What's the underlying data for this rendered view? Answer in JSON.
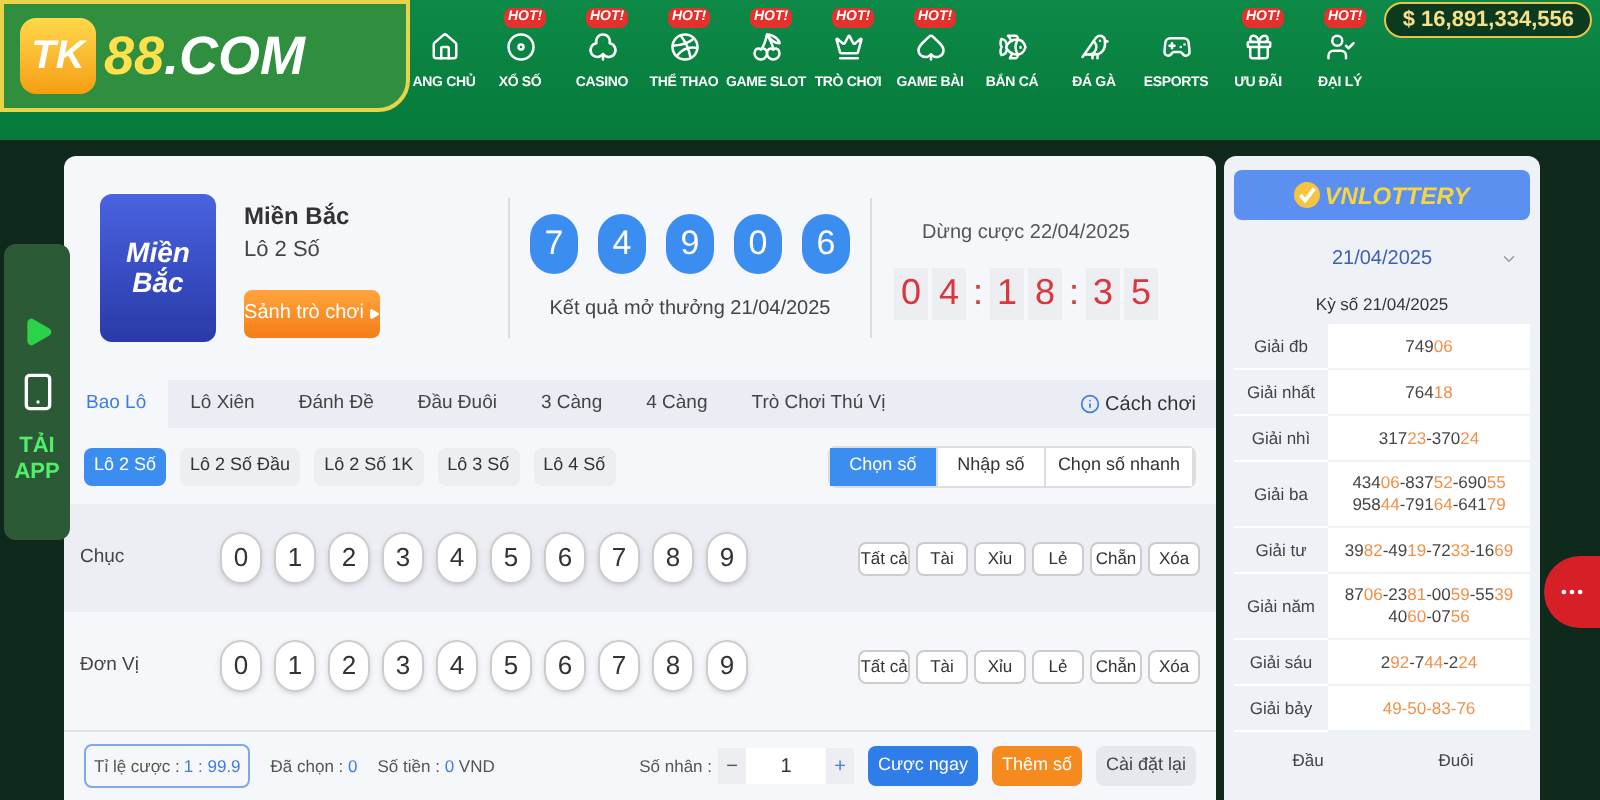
{
  "header": {
    "brand": {
      "mark": "TK",
      "accent": "88",
      "rest": ".COM"
    },
    "nav": [
      {
        "label": "ANG CHỦ"
      },
      {
        "label": "XỔ SỐ",
        "badge": "HOT!"
      },
      {
        "label": "CASINO",
        "badge": "HOT!"
      },
      {
        "label": "THỂ THAO",
        "badge": "HOT!"
      },
      {
        "label": "GAME SLOT",
        "badge": "HOT!"
      },
      {
        "label": "TRÒ CHƠI",
        "badge": "HOT!"
      },
      {
        "label": "GAME BÀI",
        "badge": "HOT!"
      },
      {
        "label": "BẮN CÁ"
      },
      {
        "label": "ĐÁ GÀ"
      },
      {
        "label": "ESPORTS"
      },
      {
        "label": "ƯU ĐÃI",
        "badge": "HOT!"
      },
      {
        "label": "ĐẠI LÝ",
        "badge": "HOT!"
      }
    ],
    "balance": "$ 16,891,334,556"
  },
  "app_widget": {
    "label": "TẢI APP"
  },
  "game": {
    "icon_text": "Miền Bắc",
    "region": "Miền Bắc",
    "type": "Lô 2 Số",
    "lobby_button": "Sảnh trò chơi",
    "balls": [
      "7",
      "4",
      "9",
      "0",
      "6"
    ],
    "result_caption": "Kết quả mở thưởng 21/04/2025",
    "deadline": "Dừng cược 22/04/2025",
    "countdown": [
      "0",
      "4",
      ":",
      "1",
      "8",
      ":",
      "3",
      "5"
    ]
  },
  "tabs": [
    {
      "label": "Bao Lô",
      "selected": true
    },
    {
      "label": "Lô Xiên",
      "selected": false
    },
    {
      "label": "Đánh Đề",
      "selected": false
    },
    {
      "label": "Đầu Đuôi",
      "selected": false
    },
    {
      "label": "3 Càng",
      "selected": false
    },
    {
      "label": "4 Càng",
      "selected": false
    },
    {
      "label": "Trò Chơi Thú Vị",
      "selected": false
    }
  ],
  "help_link": "Cách chơi",
  "subtabs": [
    {
      "label": "Lô 2 Số",
      "selected": true
    },
    {
      "label": "Lô 2 Số Đầu",
      "selected": false
    },
    {
      "label": "Lô 2 Số 1K",
      "selected": false
    },
    {
      "label": "Lô 3 Số",
      "selected": false
    },
    {
      "label": "Lô 4 Số",
      "selected": false
    }
  ],
  "modes": [
    {
      "label": "Chọn số",
      "selected": true
    },
    {
      "label": "Nhập số",
      "selected": false
    },
    {
      "label": "Chọn số nhanh",
      "selected": false
    }
  ],
  "pick_rows": [
    {
      "label": "Chục",
      "digits": [
        "0",
        "1",
        "2",
        "3",
        "4",
        "5",
        "6",
        "7",
        "8",
        "9"
      ],
      "quick": [
        "Tất cả",
        "Tài",
        "Xỉu",
        "Lẻ",
        "Chẵn",
        "Xóa"
      ]
    },
    {
      "label": "Đơn Vị",
      "digits": [
        "0",
        "1",
        "2",
        "3",
        "4",
        "5",
        "6",
        "7",
        "8",
        "9"
      ],
      "quick": [
        "Tất cả",
        "Tài",
        "Xỉu",
        "Lẻ",
        "Chẵn",
        "Xóa"
      ]
    }
  ],
  "footer": {
    "odds_label": "Tỉ lệ cược : ",
    "odds_value": "1 : 99.9",
    "chosen_label": "Đã chọn : ",
    "chosen_value": "0",
    "amount_label": "Số tiền : ",
    "amount_value": "0",
    "amount_unit": " VND",
    "multiplier_label": "Số nhân :",
    "minus": "−",
    "multiplier": "1",
    "plus": "+",
    "buttons": [
      {
        "label": "Cược ngay",
        "kind": "primary"
      },
      {
        "label": "Thêm số",
        "kind": "accent"
      },
      {
        "label": "Cài đặt lại",
        "kind": "plain"
      }
    ]
  },
  "results": {
    "logo": {
      "lead": "VN",
      "rest": "LOTTERY"
    },
    "date": "21/04/2025",
    "draw": "Kỳ số 21/04/2025",
    "prizes": [
      {
        "name": "Giải đb",
        "lines": [
          [
            {
              "text": "749",
              "hot": false
            },
            {
              "text": "06",
              "hot": true
            }
          ]
        ]
      },
      {
        "name": "Giải nhất",
        "lines": [
          [
            {
              "text": "764",
              "hot": false
            },
            {
              "text": "18",
              "hot": true
            }
          ]
        ]
      },
      {
        "name": "Giải nhì",
        "lines": [
          [
            {
              "text": "317",
              "hot": false
            },
            {
              "text": "23",
              "hot": true
            },
            {
              "text": "-370",
              "hot": false
            },
            {
              "text": "24",
              "hot": true
            }
          ]
        ]
      },
      {
        "name": "Giải ba",
        "lines": [
          [
            {
              "text": "434",
              "hot": false
            },
            {
              "text": "06",
              "hot": true
            },
            {
              "text": "-837",
              "hot": false
            },
            {
              "text": "52",
              "hot": true
            },
            {
              "text": "-690",
              "hot": false
            },
            {
              "text": "55",
              "hot": true
            }
          ],
          [
            {
              "text": "958",
              "hot": false
            },
            {
              "text": "44",
              "hot": true
            },
            {
              "text": "-791",
              "hot": false
            },
            {
              "text": "64",
              "hot": true
            },
            {
              "text": "-641",
              "hot": false
            },
            {
              "text": "79",
              "hot": true
            }
          ]
        ]
      },
      {
        "name": "Giải tư",
        "lines": [
          [
            {
              "text": "39",
              "hot": false
            },
            {
              "text": "82",
              "hot": true
            },
            {
              "text": "-49",
              "hot": false
            },
            {
              "text": "19",
              "hot": true
            },
            {
              "text": "-72",
              "hot": false
            },
            {
              "text": "33",
              "hot": true
            },
            {
              "text": "-16",
              "hot": false
            },
            {
              "text": "69",
              "hot": true
            }
          ]
        ]
      },
      {
        "name": "Giải năm",
        "lines": [
          [
            {
              "text": "87",
              "hot": false
            },
            {
              "text": "06",
              "hot": true
            },
            {
              "text": "-23",
              "hot": false
            },
            {
              "text": "81",
              "hot": true
            },
            {
              "text": "-00",
              "hot": false
            },
            {
              "text": "59",
              "hot": true
            },
            {
              "text": "-55",
              "hot": false
            },
            {
              "text": "39",
              "hot": true
            }
          ],
          [
            {
              "text": "40",
              "hot": false
            },
            {
              "text": "60",
              "hot": true
            },
            {
              "text": "-07",
              "hot": false
            },
            {
              "text": "56",
              "hot": true
            }
          ]
        ]
      },
      {
        "name": "Giải sáu",
        "lines": [
          [
            {
              "text": "2",
              "hot": false
            },
            {
              "text": "92",
              "hot": true
            },
            {
              "text": "-7",
              "hot": false
            },
            {
              "text": "44",
              "hot": true
            },
            {
              "text": "-2",
              "hot": false
            },
            {
              "text": "24",
              "hot": true
            }
          ]
        ]
      },
      {
        "name": "Giải bảy",
        "lines": [
          [
            {
              "text": "49-50-83-76",
              "hot": true
            }
          ]
        ]
      }
    ],
    "columns": [
      "Đầu",
      "Đuôi"
    ]
  }
}
